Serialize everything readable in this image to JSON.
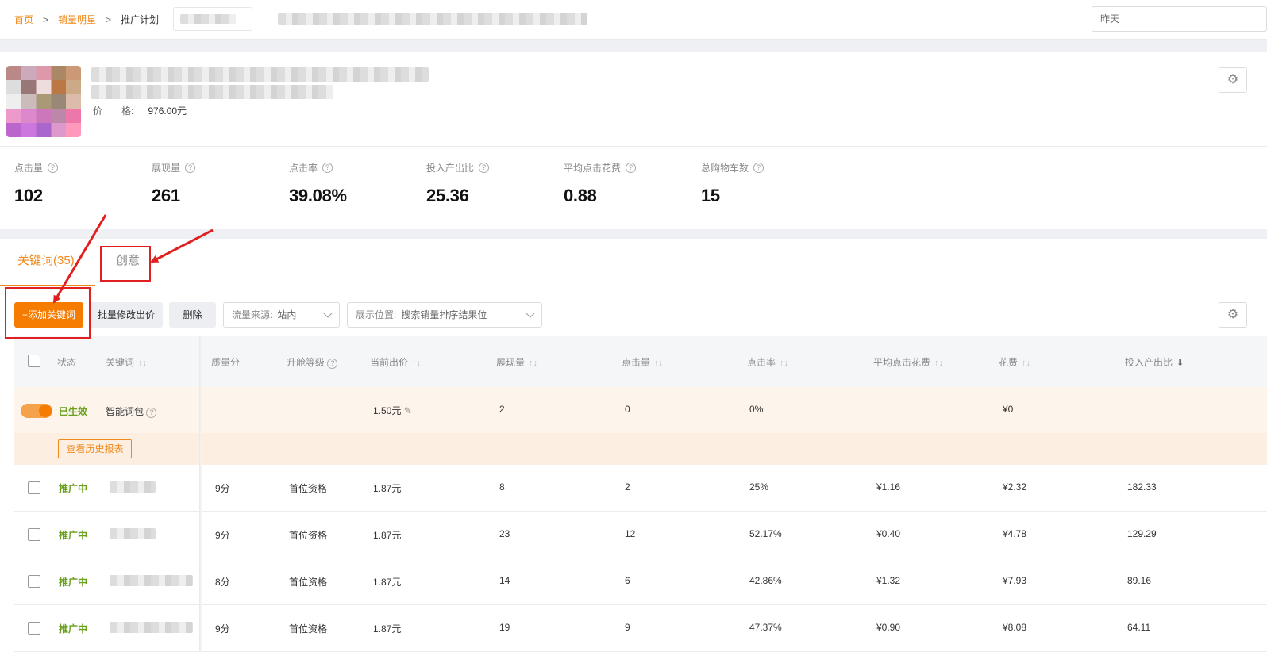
{
  "breadcrumb": {
    "home": "首页",
    "sep": ">",
    "product_star": "销量明星",
    "plan": "推广计划"
  },
  "date_range": "昨天",
  "product": {
    "price_label": "价　　格:",
    "price_value": "976.00元"
  },
  "metrics": [
    {
      "label": "点击量",
      "value": "102"
    },
    {
      "label": "展现量",
      "value": "261"
    },
    {
      "label": "点击率",
      "value": "39.08%"
    },
    {
      "label": "投入产出比",
      "value": "25.36"
    },
    {
      "label": "平均点击花费",
      "value": "0.88"
    },
    {
      "label": "总购物车数",
      "value": "15"
    }
  ],
  "tabs": {
    "keywords": "关键词(35)",
    "creative": "创意"
  },
  "toolbar": {
    "add_keyword": "+添加关键词",
    "batch_bid": "批量修改出价",
    "delete": "删除",
    "traffic_label": "流量来源:",
    "traffic_value": "站内",
    "display_label": "展示位置:",
    "display_value": "搜索销量排序结果位"
  },
  "columns": [
    "状态",
    "关键词",
    "质量分",
    "升舱等级",
    "当前出价",
    "展现量",
    "点击量",
    "点击率",
    "平均点击花费",
    "花费",
    "投入产出比"
  ],
  "smart_row": {
    "status": "已生效",
    "keyword": "智能词包",
    "bid": "1.50元",
    "impressions": "2",
    "clicks": "0",
    "ctr": "0%",
    "cost": "¥0",
    "history_button": "查看历史报表"
  },
  "rows": [
    {
      "status": "推广中",
      "quality": "9分",
      "tier": "首位资格",
      "bid": "1.87元",
      "impressions": "8",
      "clicks": "2",
      "ctr": "25%",
      "avg_cpc": "¥1.16",
      "cost": "¥2.32",
      "roi": "182.33"
    },
    {
      "status": "推广中",
      "quality": "9分",
      "tier": "首位资格",
      "bid": "1.87元",
      "impressions": "23",
      "clicks": "12",
      "ctr": "52.17%",
      "avg_cpc": "¥0.40",
      "cost": "¥4.78",
      "roi": "129.29"
    },
    {
      "status": "推广中",
      "quality": "8分",
      "tier": "首位资格",
      "bid": "1.87元",
      "impressions": "14",
      "clicks": "6",
      "ctr": "42.86%",
      "avg_cpc": "¥1.32",
      "cost": "¥7.93",
      "roi": "89.16"
    },
    {
      "status": "推广中",
      "quality": "9分",
      "tier": "首位资格",
      "bid": "1.87元",
      "impressions": "19",
      "clicks": "9",
      "ctr": "47.37%",
      "avg_cpc": "¥0.90",
      "cost": "¥8.08",
      "roi": "64.11"
    }
  ],
  "colors": {
    "accent": "#f57c00",
    "link": "#f08a1c",
    "status_green": "#6aa01e",
    "annotation_red": "#e02020"
  }
}
